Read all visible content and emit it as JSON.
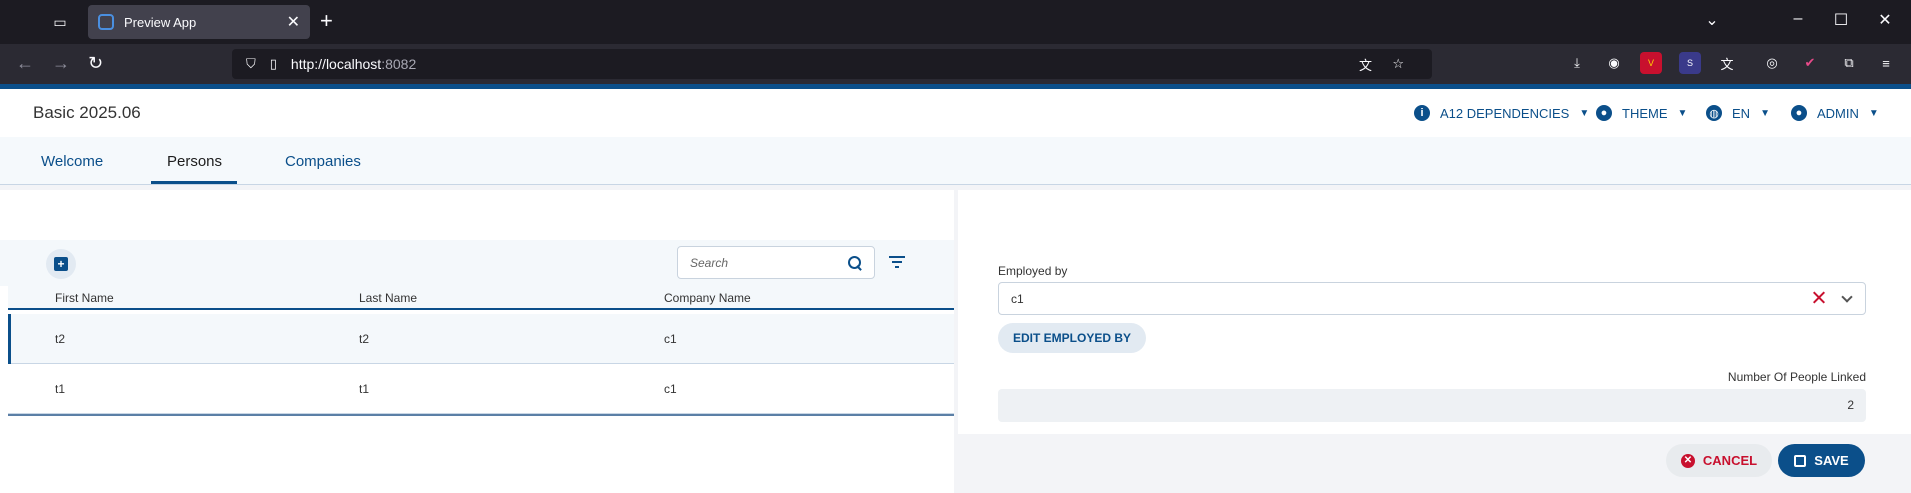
{
  "browser": {
    "tab_title": "Preview App",
    "url_host": "http://localhost",
    "url_port": ":8082",
    "icons": {
      "tab_overview": "folder-icon",
      "new_tab": "plus-icon",
      "back": "arrow-left-icon",
      "forward": "arrow-right-icon",
      "reload": "reload-icon",
      "shield": "shield-icon",
      "page": "page-icon",
      "translate": "translate-icon",
      "bookmark": "star-icon",
      "download": "download-icon",
      "account": "account-icon"
    }
  },
  "app": {
    "title": "Basic 2025.06",
    "header_menu": {
      "dependencies": "A12 DEPENDENCIES",
      "theme": "THEME",
      "language": "EN",
      "user": "ADMIN"
    },
    "tabs": [
      "Welcome",
      "Persons",
      "Companies"
    ],
    "active_tab": "Persons",
    "colors": {
      "primary": "#0b4f8a",
      "danger": "#c8102e"
    }
  },
  "list": {
    "search_placeholder": "Search",
    "columns": [
      "First Name",
      "Last Name",
      "Company Name"
    ],
    "rows": [
      {
        "first": "t2",
        "last": "t2",
        "company": "c1",
        "selected": true
      },
      {
        "first": "t1",
        "last": "t1",
        "company": "c1",
        "selected": false
      }
    ]
  },
  "detail": {
    "employed_by_label": "Employed by",
    "employed_by_value": "c1",
    "edit_button": "EDIT EMPLOYED BY",
    "people_linked_label": "Number Of People Linked",
    "people_linked_value": "2",
    "cancel_label": "CANCEL",
    "save_label": "SAVE"
  }
}
